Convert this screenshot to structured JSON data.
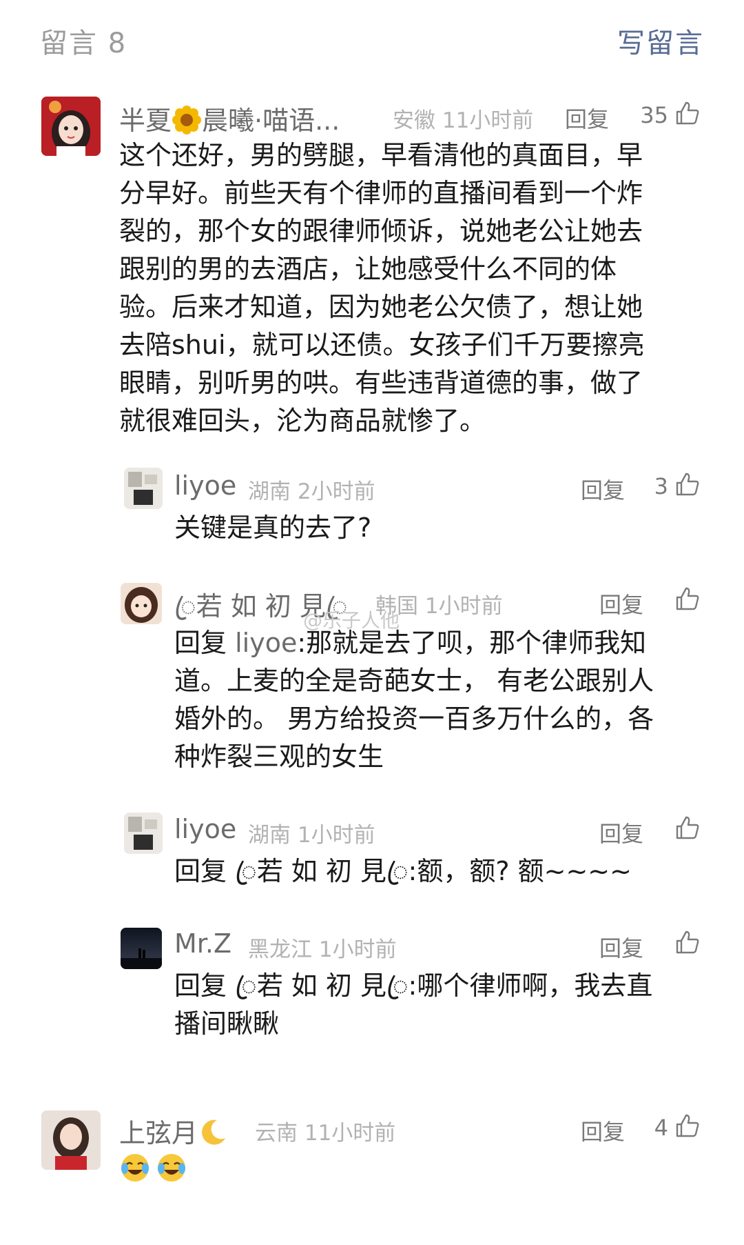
{
  "header": {
    "title": "留言 8",
    "write_label": "写留言"
  },
  "reply_label": "回复",
  "watermark": "@乐子人他",
  "comments": [
    {
      "name_a": "半夏",
      "name_b": "晨曦·喵语...",
      "location": "安徽",
      "time": "11小时前",
      "likes": "35",
      "lines": [
        "这个还好，男的劈腿，早看清他的真面目，早",
        "分早好。前些天有个律师的直播间看到一个炸",
        "裂的，那个女的跟律师倾诉，说她老公让她去",
        "跟别的男的去酒店，让她感受什么不同的体",
        "验。后来才知道，因为她老公欠债了，想让她",
        "去陪shui，就可以还债。女孩子们千万要擦亮",
        "眼睛，别听男的哄。有些违背道德的事，做了",
        "就很难回头，沦为商品就惨了。"
      ]
    },
    {
      "name": "liyoe",
      "location": "湖南",
      "time": "2小时前",
      "likes": "3",
      "lines": [
        "关键是真的去了?"
      ]
    },
    {
      "name": "ꦿ若 如 初 見ꦿ",
      "location": "韩国",
      "time": "1小时前",
      "likes": "",
      "reply_prefix": "回复 ",
      "mention": "liyoe",
      "lines": [
        ":那就是去了呗，那个律师我知",
        "道。上麦的全是奇葩女士， 有老公跟别人",
        "婚外的。 男方给投资一百多万什么的，各",
        "种炸裂三观的女生"
      ]
    },
    {
      "name": "liyoe",
      "location": "湖南",
      "time": "1小时前",
      "likes": "",
      "lines": [
        "回复 ꦿ若 如 初 見ꦿ:额，额? 额~~~~"
      ]
    },
    {
      "name": "Mr.Z",
      "location": "黑龙江",
      "time": "1小时前",
      "likes": "",
      "lines": [
        "回复 ꦿ若 如 初 見ꦿ:哪个律师啊，我去直",
        "播间瞅瞅"
      ]
    },
    {
      "name": "上弦月",
      "location": "云南",
      "time": "11小时前",
      "likes": "4",
      "lines": []
    }
  ]
}
